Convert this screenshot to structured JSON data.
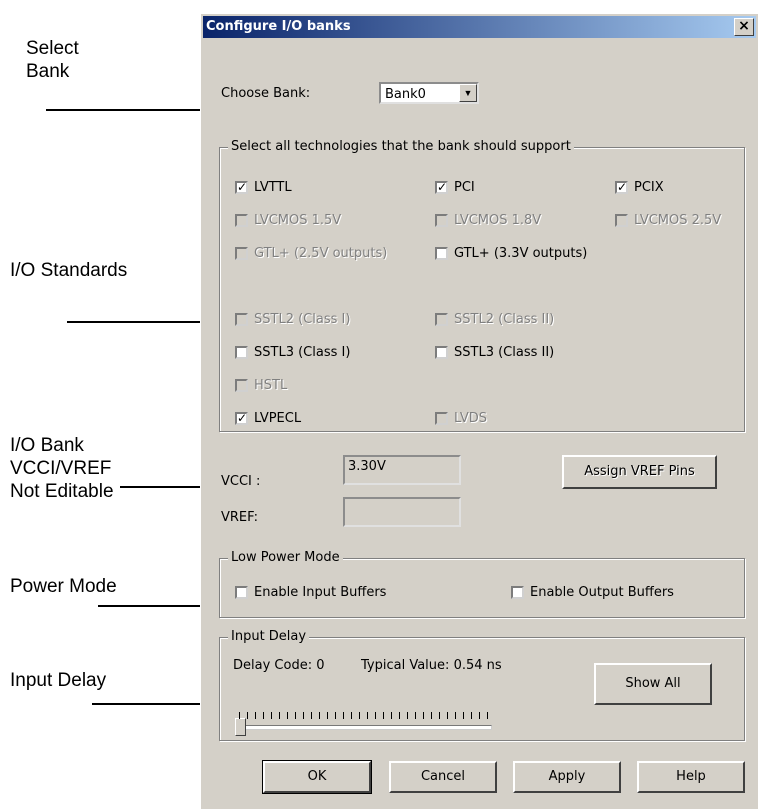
{
  "annotations": {
    "select_bank": "Select\nBank",
    "io_standards": "I/O Standards",
    "io_bank": "I/O Bank\nVCCI/VREF\nNot Editable",
    "power_mode": "Power Mode",
    "input_delay": "Input Delay"
  },
  "dialog": {
    "title": "Configure I/O banks",
    "close_label": "×"
  },
  "bank": {
    "label": "Choose Bank:",
    "value": "Bank0"
  },
  "technologies": {
    "legend": "Select all technologies that the bank should support",
    "items": [
      {
        "label": "LVTTL",
        "checked": true,
        "enabled": true
      },
      {
        "label": "PCI",
        "checked": true,
        "enabled": true
      },
      {
        "label": "PCIX",
        "checked": true,
        "enabled": true
      },
      {
        "label": "LVCMOS 1.5V",
        "checked": false,
        "enabled": false
      },
      {
        "label": "LVCMOS 1.8V",
        "checked": false,
        "enabled": false
      },
      {
        "label": "LVCMOS 2.5V",
        "checked": false,
        "enabled": false
      },
      {
        "label": "GTL+ (2.5V outputs)",
        "checked": false,
        "enabled": false
      },
      {
        "label": "GTL+ (3.3V outputs)",
        "checked": false,
        "enabled": true
      },
      {
        "label": "SSTL2 (Class I)",
        "checked": false,
        "enabled": false
      },
      {
        "label": "SSTL2 (Class II)",
        "checked": false,
        "enabled": false
      },
      {
        "label": "SSTL3 (Class I)",
        "checked": false,
        "enabled": true
      },
      {
        "label": "SSTL3 (Class II)",
        "checked": false,
        "enabled": true
      },
      {
        "label": "HSTL",
        "checked": false,
        "enabled": false
      },
      {
        "label": "LVPECL",
        "checked": true,
        "enabled": true
      },
      {
        "label": "LVDS",
        "checked": false,
        "enabled": false
      }
    ]
  },
  "voltage": {
    "vcci_label": "VCCI :",
    "vcci_value": "3.30V",
    "vref_label": "VREF:",
    "vref_value": "",
    "assign_button": "Assign VREF Pins"
  },
  "power": {
    "legend": "Low Power Mode",
    "input_buffers": "Enable Input Buffers",
    "output_buffers": "Enable Output Buffers"
  },
  "delay": {
    "legend": "Input Delay",
    "code_label": "Delay Code:",
    "code_value": "0",
    "typical_label": "Typical Value:",
    "typical_value": "0.54 ns",
    "show_all": "Show All",
    "slider_value": 0
  },
  "buttons": {
    "ok": "OK",
    "cancel": "Cancel",
    "apply": "Apply",
    "help": "Help"
  }
}
